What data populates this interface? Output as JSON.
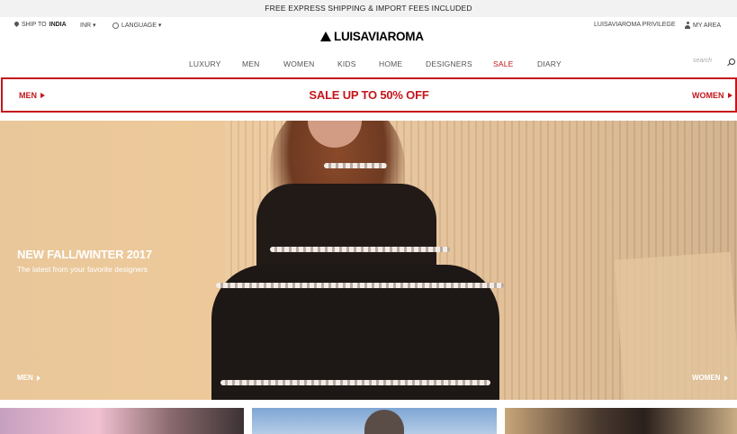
{
  "topbar": {
    "text": "FREE EXPRESS SHIPPING & IMPORT FEES INCLUDED"
  },
  "utility": {
    "ship_prefix": "SHIP TO",
    "ship_country": "INDIA",
    "currency": "INR ▾",
    "language": "LANGUAGE ▾",
    "privilege": "LUISAVIAROMA PRIVILEGE",
    "my_area": "MY AREA"
  },
  "logo": {
    "text": "LUISAVIAROMA"
  },
  "nav": {
    "items": [
      "LUXURY",
      "MEN",
      "WOMEN",
      "KIDS",
      "HOME",
      "DESIGNERS",
      "SALE",
      "DIARY"
    ],
    "search_placeholder": "search"
  },
  "sale_banner": {
    "left": "MEN",
    "center": "SALE UP TO 50% OFF",
    "right": "WOMEN"
  },
  "hero": {
    "title": "NEW FALL/WINTER 2017",
    "subtitle": "The latest from your favorite designers",
    "left_link": "MEN",
    "right_link": "WOMEN"
  },
  "colors": {
    "accent": "#c4161c",
    "topbar_bg": "#f2f2f2"
  },
  "icons": [
    "location-pin-icon",
    "globe-icon",
    "user-icon",
    "search-icon",
    "arrow-right-icon",
    "logo-triangle-icon"
  ]
}
